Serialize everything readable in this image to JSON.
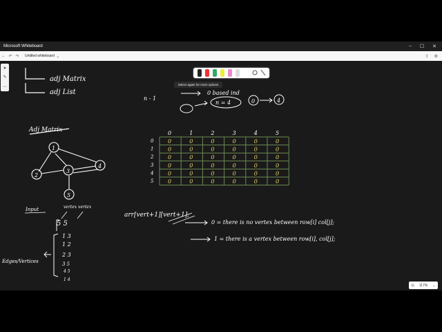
{
  "window": {
    "title": "Microsoft Whiteboard"
  },
  "toolbar": {
    "document_title": "Untitled whiteboard"
  },
  "tooltip": {
    "text": "Select again for more options"
  },
  "zoom": {
    "value": "117%"
  },
  "notes": {
    "line1": "adj Matrix",
    "line2": "adj List",
    "heading": "Adj Matrix",
    "n1": "n - 1",
    "zero_based": "0 based ind",
    "n4": "n = 4",
    "o1": "0",
    "o2": "4",
    "input": "Input",
    "vertex_label": "vertex  vertex",
    "vertex_counts": "5  5",
    "edges_label": "Edges/Vertices",
    "edges": [
      "1  3",
      "1  2",
      "2  3",
      "3  5",
      "4  5",
      "1  4"
    ],
    "arr_decl": "arr[vert+1][vert+1];",
    "rule0": "0 = there is no vertex between row[i] col[j];",
    "rule1": "1 = there is a vertex between row[i], col[j];"
  },
  "graph": {
    "nodes": [
      "1",
      "2",
      "3",
      "4",
      "5"
    ]
  },
  "matrix": {
    "col_headers": [
      "0",
      "1",
      "2",
      "3",
      "4",
      "5"
    ],
    "row_headers": [
      "0",
      "1",
      "2",
      "3",
      "4",
      "5"
    ],
    "cells": [
      [
        "0",
        "0",
        "0",
        "0",
        "0",
        "0"
      ],
      [
        "0",
        "0",
        "0",
        "0",
        "0",
        "0"
      ],
      [
        "0",
        "0",
        "0",
        "0",
        "0",
        "0"
      ],
      [
        "0",
        "0",
        "0",
        "0",
        "0",
        "0"
      ],
      [
        "0",
        "0",
        "0",
        "0",
        "0",
        "0"
      ],
      [
        "0",
        "0",
        "0",
        "0",
        "0",
        "0"
      ]
    ]
  },
  "colors": {
    "ink": "#ffffff",
    "matrix_ink": "#e8d96a",
    "grid": "#6f8a4f",
    "canvas": "#1a1a1a"
  }
}
